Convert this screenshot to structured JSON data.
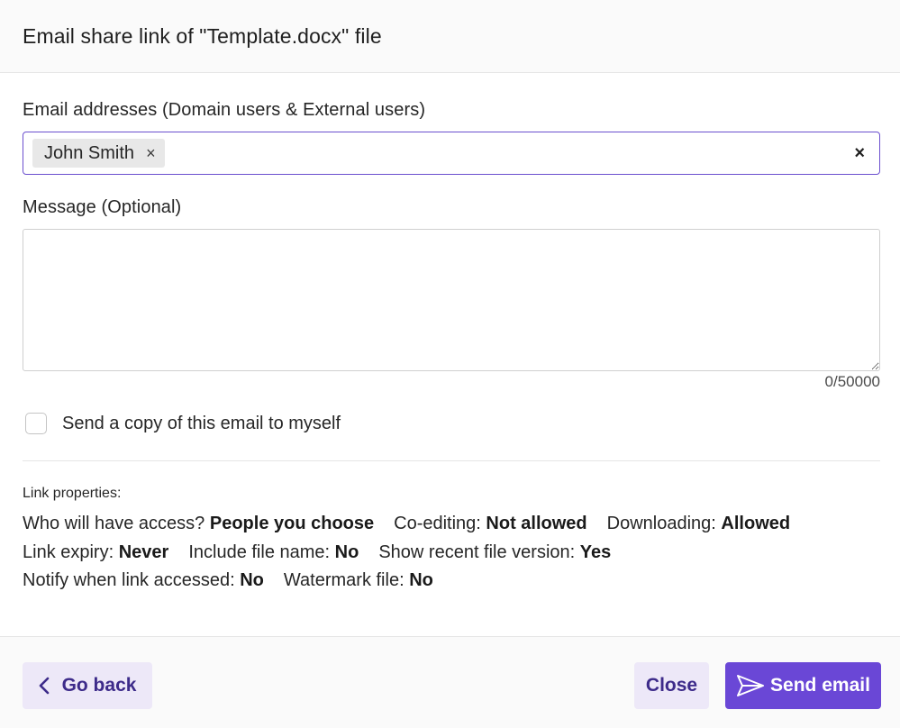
{
  "dialog": {
    "title": "Email share link of \"Template.docx\" file"
  },
  "recipients": {
    "label": "Email addresses (Domain users & External users)",
    "chips": [
      {
        "name": "John Smith"
      }
    ],
    "remove_glyph": "×",
    "clear_glyph": "×",
    "input_value": ""
  },
  "message": {
    "label": "Message (Optional)",
    "value": "",
    "counter": "0/50000"
  },
  "copy_to_self": {
    "label": "Send a copy of this email to myself",
    "checked": false
  },
  "link_properties": {
    "title": "Link properties:",
    "rows": [
      [
        {
          "label": "Who will have access?",
          "value": "People you choose"
        },
        {
          "label": "Co-editing:",
          "value": "Not allowed"
        },
        {
          "label": "Downloading:",
          "value": "Allowed"
        }
      ],
      [
        {
          "label": "Link expiry:",
          "value": "Never"
        },
        {
          "label": "Include file name:",
          "value": "No"
        },
        {
          "label": "Show recent file version:",
          "value": "Yes"
        }
      ],
      [
        {
          "label": "Notify when link accessed:",
          "value": "No"
        },
        {
          "label": "Watermark file:",
          "value": "No"
        }
      ]
    ]
  },
  "footer": {
    "back_label": "Go back",
    "close_label": "Close",
    "send_label": "Send email",
    "back_icon": "chevron-left-icon",
    "send_icon": "send-icon"
  },
  "colors": {
    "accent": "#6a47d6",
    "secondary_button_bg": "#ede8f8",
    "secondary_button_text": "#3d2b8a",
    "focus_border": "#6b4fcf"
  }
}
